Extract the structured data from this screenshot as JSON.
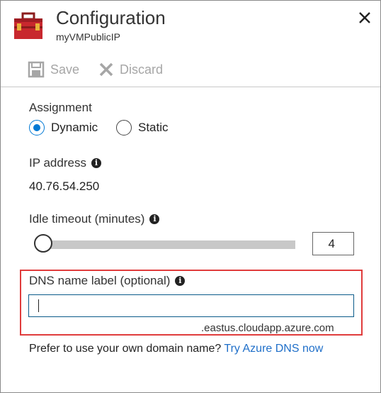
{
  "header": {
    "title": "Configuration",
    "subtitle": "myVMPublicIP",
    "app_icon": "toolbox-icon",
    "close_icon": "close-icon"
  },
  "toolbar": {
    "save_label": "Save",
    "discard_label": "Discard",
    "disabled_color": "#a6a6a6"
  },
  "assignment": {
    "label": "Assignment",
    "options": [
      "Dynamic",
      "Static"
    ],
    "selected": "Dynamic"
  },
  "ip": {
    "label": "IP address",
    "value": "40.76.54.250"
  },
  "idle_timeout": {
    "label": "Idle timeout (minutes)",
    "value": "4"
  },
  "dns": {
    "label": "DNS name label (optional)",
    "value": "",
    "suffix": ".eastus.cloudapp.azure.com"
  },
  "footer": {
    "text": "Prefer to use your own domain name? ",
    "link": "Try Azure DNS now"
  },
  "colors": {
    "accent": "#0078d4",
    "highlight": "#e03c3c",
    "link": "#1f6fc9"
  }
}
